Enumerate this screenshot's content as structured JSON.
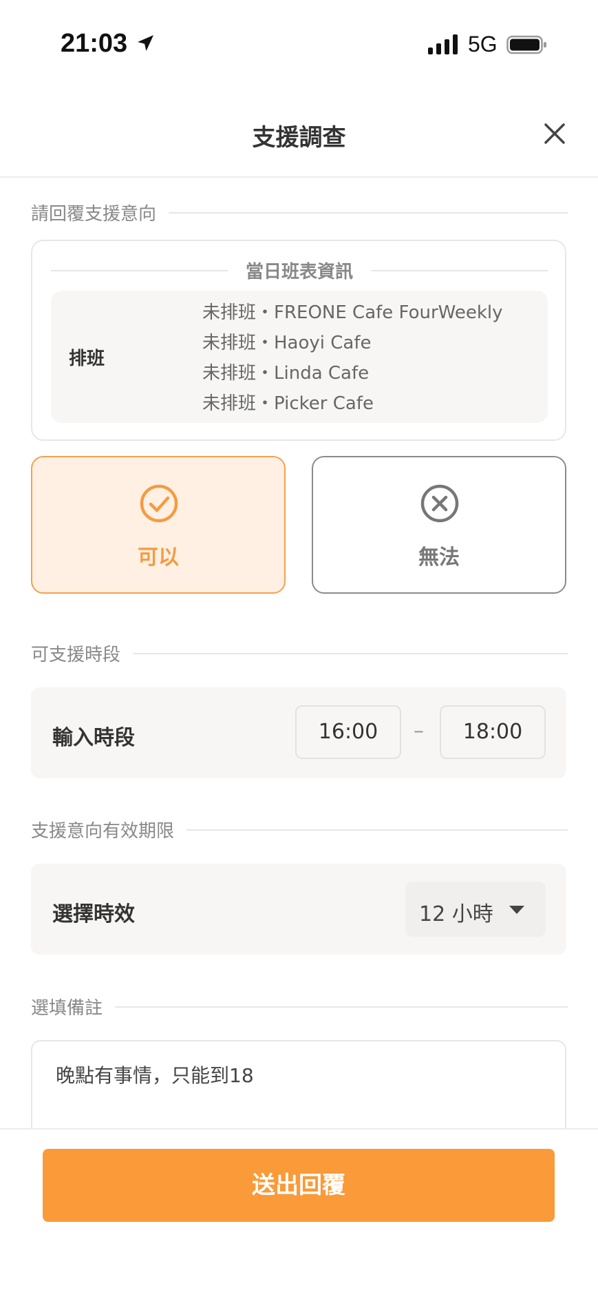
{
  "status_bar": {
    "time": "21:03",
    "network": "5G",
    "icons": [
      "location-arrow-icon",
      "signal-icon",
      "battery-icon"
    ]
  },
  "header": {
    "title": "支援調查",
    "close_icon": "close-icon"
  },
  "sections": {
    "intent": "請回覆支援意向",
    "time_range": "可支援時段",
    "validity": "支援意向有效期限",
    "note": "選填備註"
  },
  "schedule": {
    "heading": "當日班表資訊",
    "label": "排班",
    "items": [
      "未排班・FREONE Cafe FourWeekly",
      "未排班・Haoyi Cafe",
      "未排班・Linda Cafe",
      "未排班・Picker Cafe"
    ]
  },
  "choices": {
    "yes": {
      "label": "可以",
      "icon": "check-circle-icon",
      "selected": true
    },
    "no": {
      "label": "無法",
      "icon": "x-circle-icon",
      "selected": false
    }
  },
  "time_input": {
    "label": "輸入時段",
    "start": "16:00",
    "separator": "–",
    "end": "18:00"
  },
  "validity": {
    "label": "選擇時效",
    "value": "12 小時"
  },
  "note": {
    "value": "晚點有事情，只能到18"
  },
  "submit_label": "送出回覆",
  "colors": {
    "accent": "#fa9a38",
    "selected_bg": "#fff0e3",
    "panel_bg": "#f7f6f5"
  }
}
